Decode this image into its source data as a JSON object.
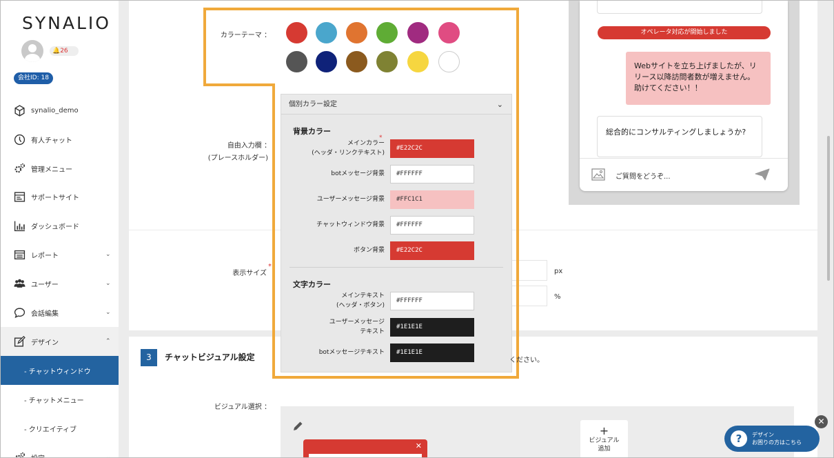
{
  "sidebar": {
    "logo": "SYNALIO",
    "notification_count": "🔔26",
    "company_id": "会社ID: 18",
    "items": [
      {
        "label": "synalio_demo",
        "icon": "cube-icon"
      },
      {
        "label": "有人チャット",
        "icon": "headset-icon"
      },
      {
        "label": "管理メニュー",
        "icon": "gears-icon"
      },
      {
        "label": "サポートサイト",
        "icon": "window-icon"
      },
      {
        "label": "ダッシュボード",
        "icon": "bar-chart-icon"
      },
      {
        "label": "レポート",
        "icon": "list-icon",
        "chevron": "⌄"
      },
      {
        "label": "ユーザー",
        "icon": "users-icon",
        "chevron": "⌄"
      },
      {
        "label": "会話編集",
        "icon": "chat-icon",
        "chevron": "⌄"
      },
      {
        "label": "デザイン",
        "icon": "edit-icon",
        "chevron": "⌃"
      },
      {
        "label": "- チャットウィンドウ"
      },
      {
        "label": "- チャットメニュー"
      },
      {
        "label": "- クリエイティブ"
      },
      {
        "label": "設定",
        "icon": "settings-icon",
        "chevron": "⌄"
      }
    ]
  },
  "form": {
    "color_theme_label": "カラーテーマ ：",
    "free_input_label": "自由入力欄 ：",
    "free_input_sub": "(プレースホルダー)",
    "display_size_label": "表示サイズ",
    "px_unit": "px",
    "pct_unit": "%"
  },
  "theme_colors": [
    "#d63a32",
    "#4aa6cc",
    "#e07430",
    "#5fac35",
    "#a02b80",
    "#e04c82",
    "#555555",
    "#0f2279",
    "#8b5a1e",
    "#7f8233",
    "#f6d640",
    "#ffffff"
  ],
  "color_panel": {
    "title": "個別カラー設定",
    "chevron": "⌄",
    "bg_section": "背景カラー",
    "text_section": "文字カラー",
    "fields": [
      {
        "label1": "メインカラー",
        "label2": "(ヘッダ・リンクテキスト)",
        "value": "#E22C2C",
        "bg": "#d63a32",
        "fg": "#ffffff",
        "required": true
      },
      {
        "label1": "botメッセージ背景",
        "label2": "",
        "value": "#FFFFFF",
        "bg": "#ffffff",
        "fg": "#333333"
      },
      {
        "label1": "ユーザーメッセージ背景",
        "label2": "",
        "value": "#FFC1C1",
        "bg": "#f6c1c1",
        "fg": "#333333"
      },
      {
        "label1": "チャットウィンドウ背景",
        "label2": "",
        "value": "#FFFFFF",
        "bg": "#ffffff",
        "fg": "#333333"
      },
      {
        "label1": "ボタン背景",
        "label2": "",
        "value": "#E22C2C",
        "bg": "#d63a32",
        "fg": "#ffffff"
      },
      {
        "label1": "メインテキスト",
        "label2": "(ヘッダ・ボタン)",
        "value": "#FFFFFF",
        "bg": "#ffffff",
        "fg": "#333333"
      },
      {
        "label1": "ユーザーメッセージ",
        "label2": "テキスト",
        "value": "#1E1E1E",
        "bg": "#1e1e1e",
        "fg": "#ffffff"
      },
      {
        "label1": "botメッセージテキスト",
        "label2": "",
        "value": "#1E1E1E",
        "bg": "#1e1e1e",
        "fg": "#ffffff"
      }
    ]
  },
  "preview": {
    "operator_banner": "オペレータ対応が開始しました",
    "user_message": "Webサイトを立ち上げましたが、リリース以降訪問者数が増えません。助けてください！！",
    "bot_message": "総合的にコンサルティングしましょうか?",
    "input_placeholder": "ご質問をどうぞ..."
  },
  "section3": {
    "number": "3",
    "title": "チャットビジュアル設定",
    "hint": "ください。",
    "visual_select_label": "ビジュアル選択 ：",
    "add_visual_plus": "+",
    "add_visual_label1": "ビジュアル",
    "add_visual_label2": "追加"
  },
  "help": {
    "line1": "デザイン",
    "line2": "お困りの方はこちら",
    "q": "?",
    "close": "✕"
  }
}
